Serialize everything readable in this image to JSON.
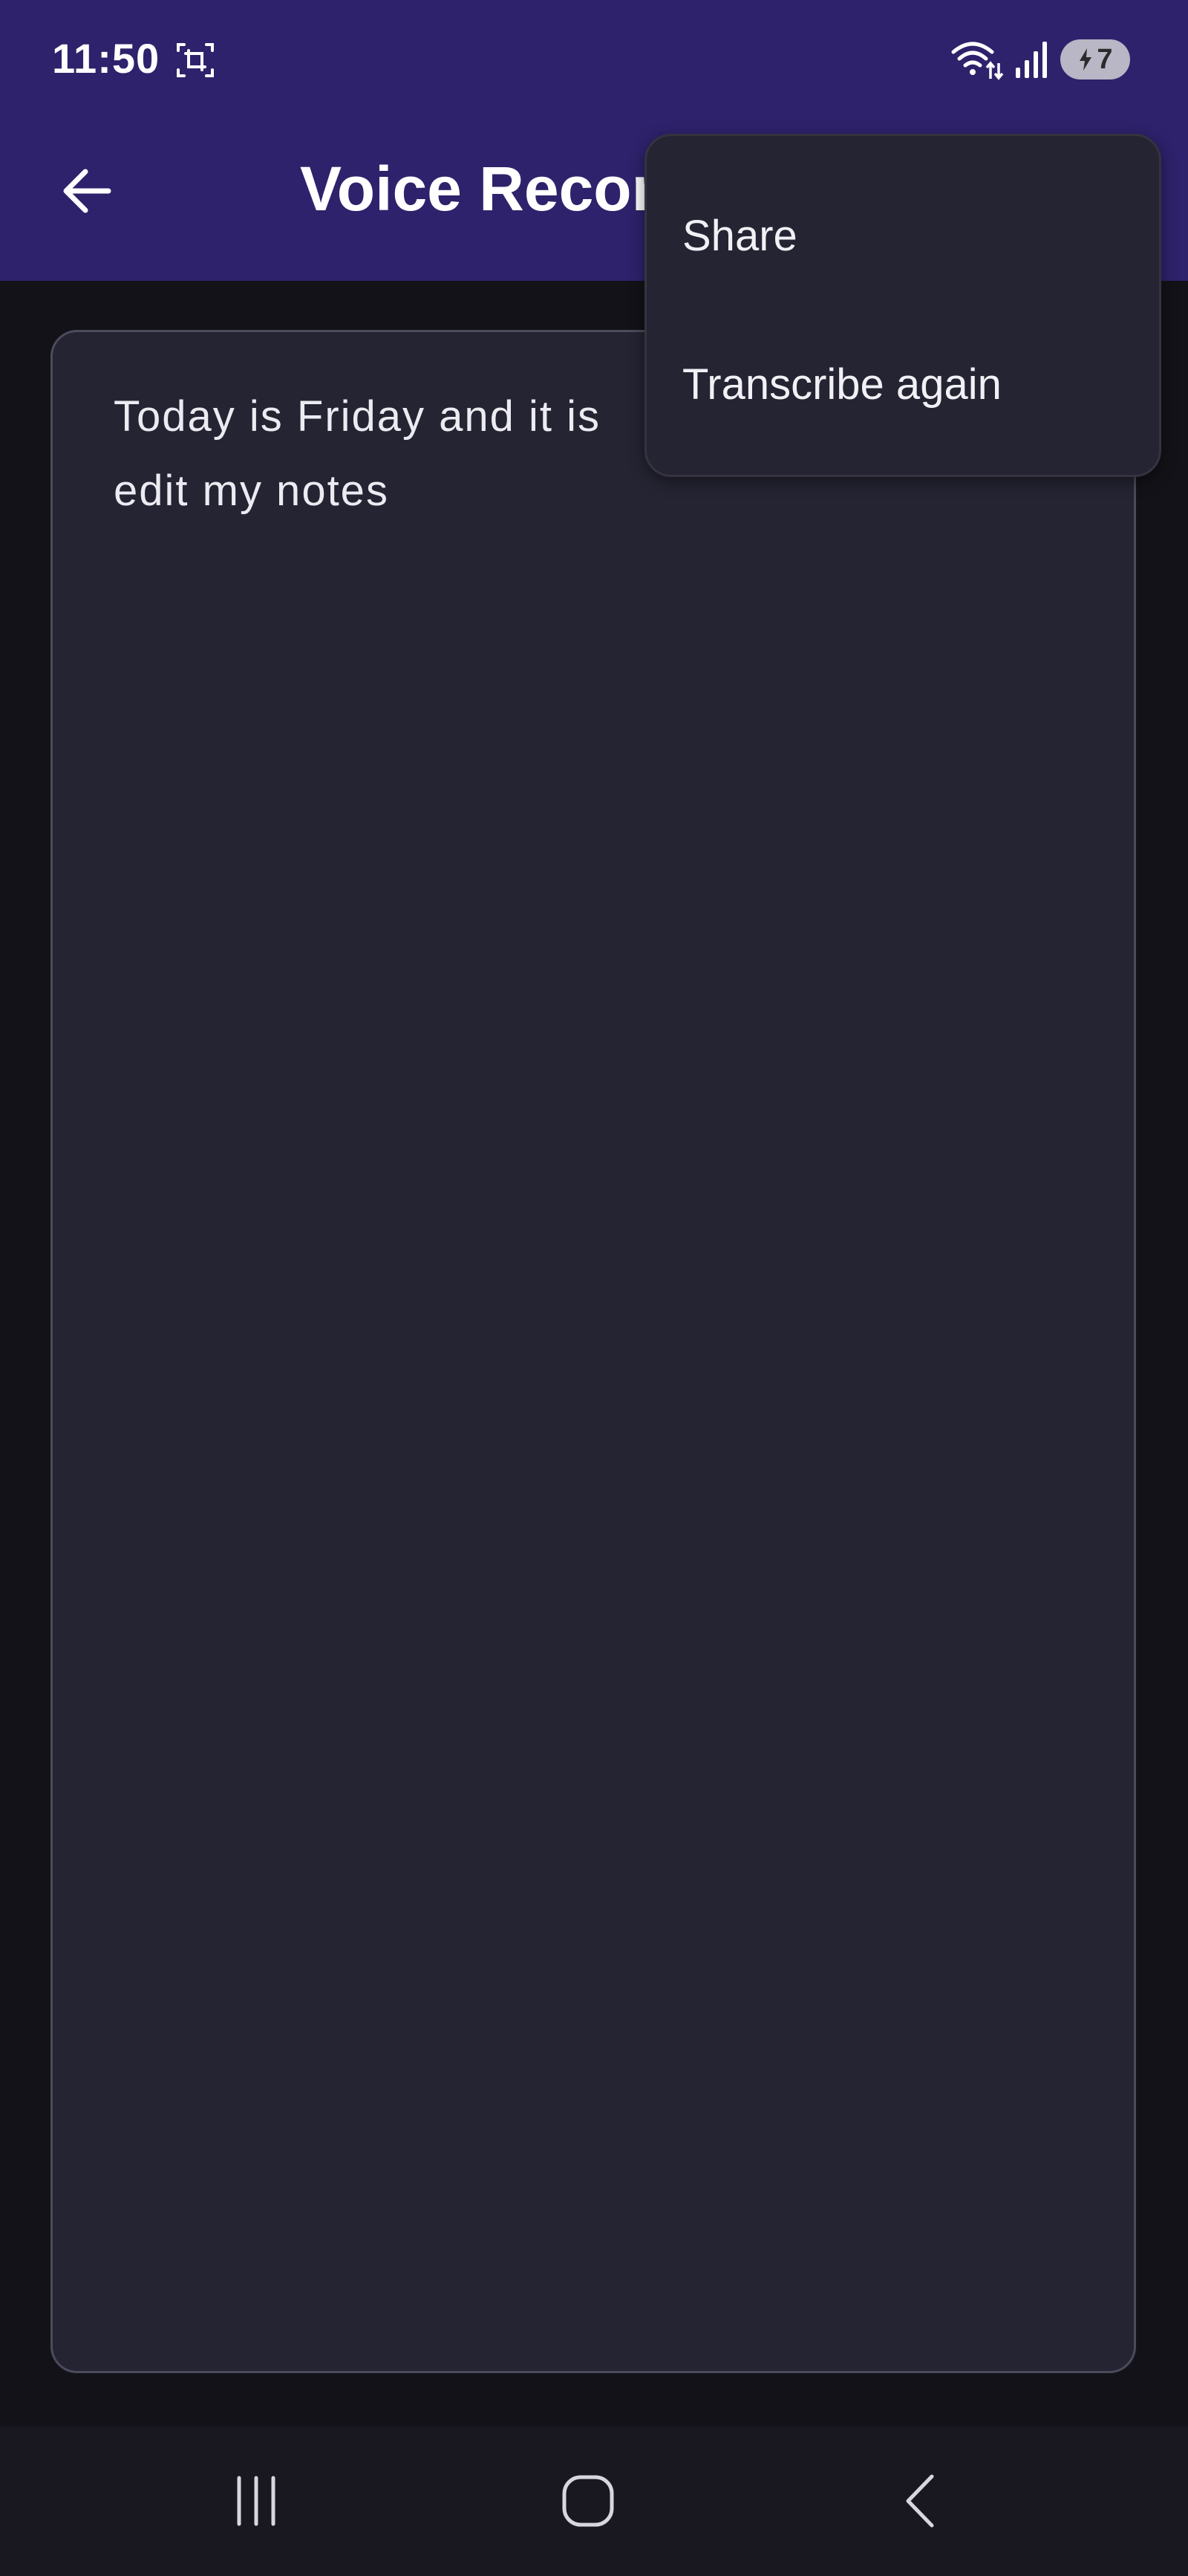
{
  "status_bar": {
    "time": "11:50",
    "battery_level": "7",
    "icons": [
      "screenshot-icon",
      "wifi-icon",
      "signal-icon",
      "battery-charging-icon"
    ]
  },
  "app_bar": {
    "title": "Voice Recor",
    "back_icon": "arrow-left-icon",
    "background_color": "#2e226c"
  },
  "note": {
    "text": "Today is Friday and it is\nedit my notes"
  },
  "menu": {
    "items": [
      {
        "label": "Share"
      },
      {
        "label": "Transcribe again"
      }
    ]
  },
  "nav_bar": {
    "buttons": [
      "recents-icon",
      "home-icon",
      "back-icon"
    ]
  }
}
